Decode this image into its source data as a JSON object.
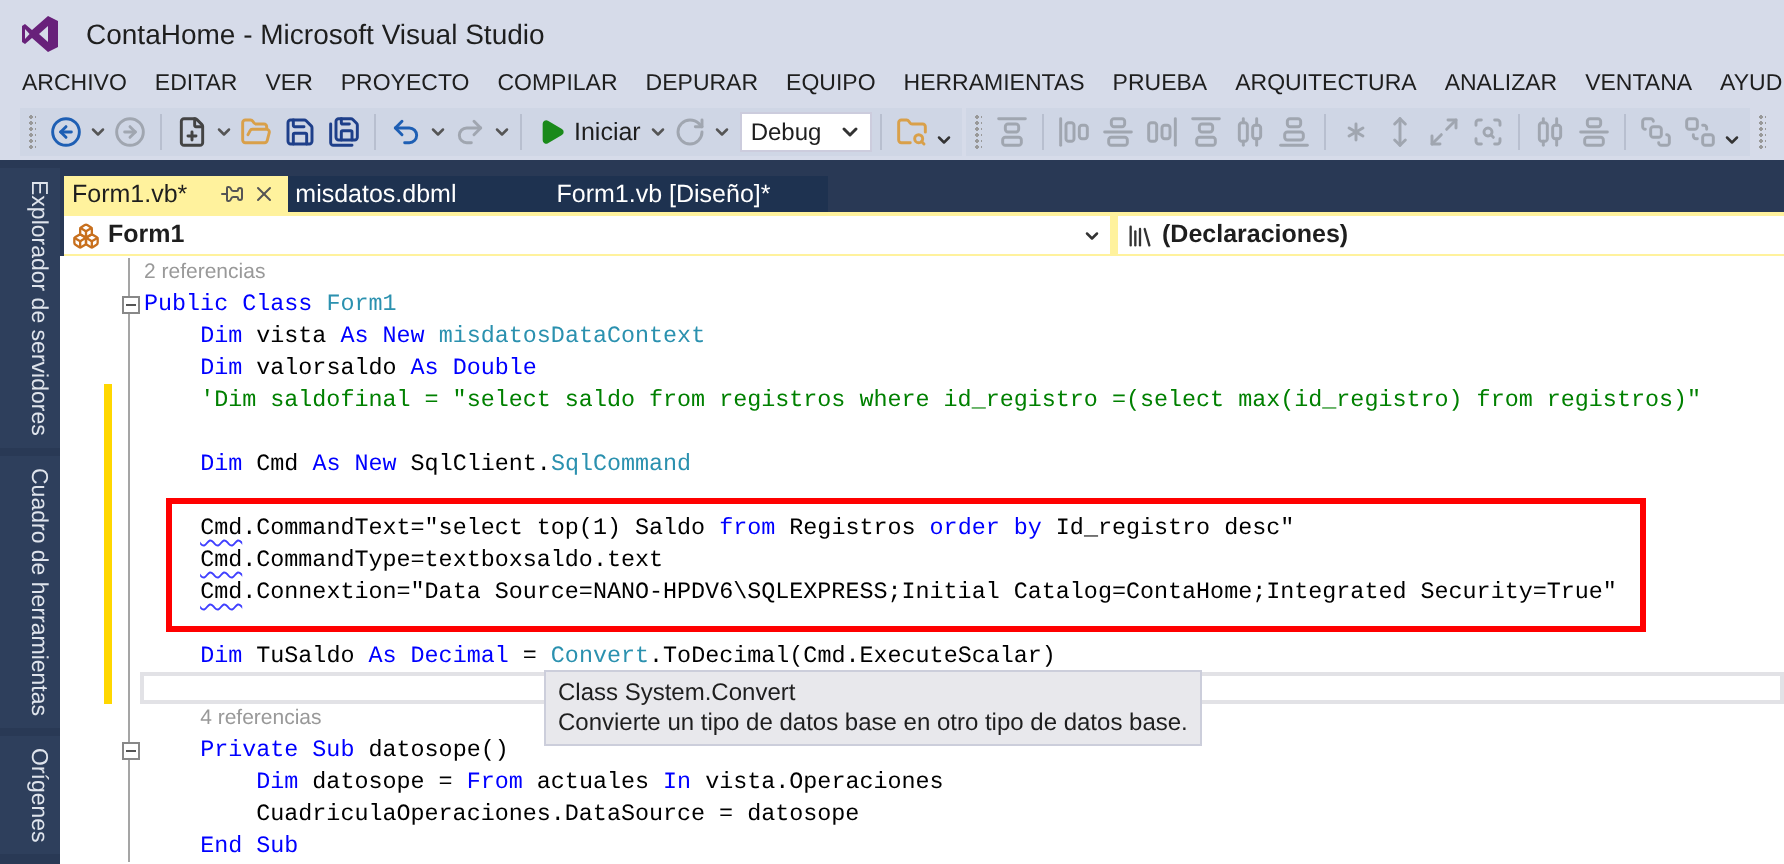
{
  "window": {
    "title": "ContaHome - Microsoft Visual Studio"
  },
  "menu": [
    "ARCHIVO",
    "EDITAR",
    "VER",
    "PROYECTO",
    "COMPILAR",
    "DEPURAR",
    "EQUIPO",
    "HERRAMIENTAS",
    "PRUEBA",
    "ARQUITECTURA",
    "ANALIZAR",
    "VENTANA",
    "AYUD"
  ],
  "toolbar": {
    "start_label": "Iniciar",
    "configuration": "Debug"
  },
  "side_panels": [
    "Explorador de servidores",
    "Cuadro de herramientas",
    "Orígenes"
  ],
  "tabs": [
    {
      "label": "Form1.vb*",
      "selected": true
    },
    {
      "label": "misdatos.dbml",
      "selected": false
    },
    {
      "label": "Form1.vb [Diseño]*",
      "selected": false
    }
  ],
  "nav_bar": {
    "type": "Form1",
    "member": "(Declaraciones)"
  },
  "code_lines": [
    {
      "kind": "lens",
      "text": "2 referencias"
    },
    {
      "kind": "code",
      "fold": true,
      "tokens": [
        {
          "text": "Public Class ",
          "kind": "keyword"
        },
        {
          "text": "Form1",
          "kind": "type"
        }
      ]
    },
    {
      "kind": "code",
      "tokens": [
        {
          "text": "    Dim",
          "kind": "keyword"
        },
        {
          "text": " vista ",
          "kind": "plain"
        },
        {
          "text": "As New ",
          "kind": "keyword"
        },
        {
          "text": "misdatosDataContext",
          "kind": "type"
        }
      ]
    },
    {
      "kind": "code",
      "tokens": [
        {
          "text": "    Dim",
          "kind": "keyword"
        },
        {
          "text": " valorsaldo ",
          "kind": "plain"
        },
        {
          "text": "As Double",
          "kind": "keyword"
        }
      ]
    },
    {
      "kind": "code",
      "changed": true,
      "tokens": [
        {
          "text": "    'Dim saldofinal = \"select saldo from registros where id_registro =(select max(id_registro) from registros)\"",
          "kind": "comment"
        }
      ]
    },
    {
      "kind": "code",
      "changed": true
    },
    {
      "kind": "code",
      "changed": true,
      "tokens": [
        {
          "text": "    Dim",
          "kind": "keyword"
        },
        {
          "text": " Cmd ",
          "kind": "plain"
        },
        {
          "text": "As New",
          "kind": "keyword"
        },
        {
          "text": " SqlClient.",
          "kind": "plain"
        },
        {
          "text": "SqlCommand",
          "kind": "type"
        }
      ]
    },
    {
      "kind": "code",
      "changed": true
    },
    {
      "kind": "code",
      "changed": true,
      "highlighted": true,
      "tokens": [
        {
          "text": "    Cmd",
          "kind": "error"
        },
        {
          "text": ".CommandText=\"select top(1) Saldo ",
          "kind": "plain"
        },
        {
          "text": "from",
          "kind": "keyword"
        },
        {
          "text": " Registros ",
          "kind": "plain"
        },
        {
          "text": "order by",
          "kind": "keyword"
        },
        {
          "text": " Id_registro desc\"",
          "kind": "plain"
        }
      ]
    },
    {
      "kind": "code",
      "changed": true,
      "highlighted": true,
      "tokens": [
        {
          "text": "    Cmd",
          "kind": "error"
        },
        {
          "text": ".CommandType=textboxsaldo.text",
          "kind": "plain"
        }
      ]
    },
    {
      "kind": "code",
      "changed": true,
      "highlighted": true,
      "tokens": [
        {
          "text": "    Cmd",
          "kind": "error"
        },
        {
          "text": ".Connextion=\"Data Source=NANO-HPDV6\\SQLEXPRESS;Initial Catalog=ContaHome;Integrated Security=True\"",
          "kind": "plain"
        }
      ]
    },
    {
      "kind": "code",
      "changed": true
    },
    {
      "kind": "code",
      "changed": true,
      "tokens": [
        {
          "text": "    Dim",
          "kind": "keyword"
        },
        {
          "text": " TuSaldo ",
          "kind": "plain"
        },
        {
          "text": "As Decimal",
          "kind": "keyword"
        },
        {
          "text": " = ",
          "kind": "plain"
        },
        {
          "text": "Convert",
          "kind": "type"
        },
        {
          "text": ".ToDecimal(Cmd.ExecuteScalar)",
          "kind": "plain"
        }
      ]
    },
    {
      "kind": "code",
      "changed": true,
      "current": true
    },
    {
      "kind": "lens",
      "text": "4 referencias"
    },
    {
      "kind": "code",
      "fold": true,
      "tokens": [
        {
          "text": "    Private Sub",
          "kind": "keyword"
        },
        {
          "text": " datosope()",
          "kind": "plain"
        }
      ]
    },
    {
      "kind": "code",
      "tokens": [
        {
          "text": "        Dim",
          "kind": "keyword"
        },
        {
          "text": " datosope = ",
          "kind": "plain"
        },
        {
          "text": "From",
          "kind": "keyword"
        },
        {
          "text": " actuales ",
          "kind": "plain"
        },
        {
          "text": "In",
          "kind": "keyword"
        },
        {
          "text": " vista.Operaciones",
          "kind": "plain"
        }
      ]
    },
    {
      "kind": "code",
      "tokens": [
        {
          "text": "        CuadriculaOperaciones.DataSource = datosope",
          "kind": "plain"
        }
      ]
    },
    {
      "kind": "code",
      "tokens": [
        {
          "text": "    End Sub",
          "kind": "keyword"
        }
      ]
    }
  ],
  "tooltip": {
    "title": "Class System.Convert",
    "description": "Convierte un tipo de datos base en otro tipo de datos base."
  }
}
